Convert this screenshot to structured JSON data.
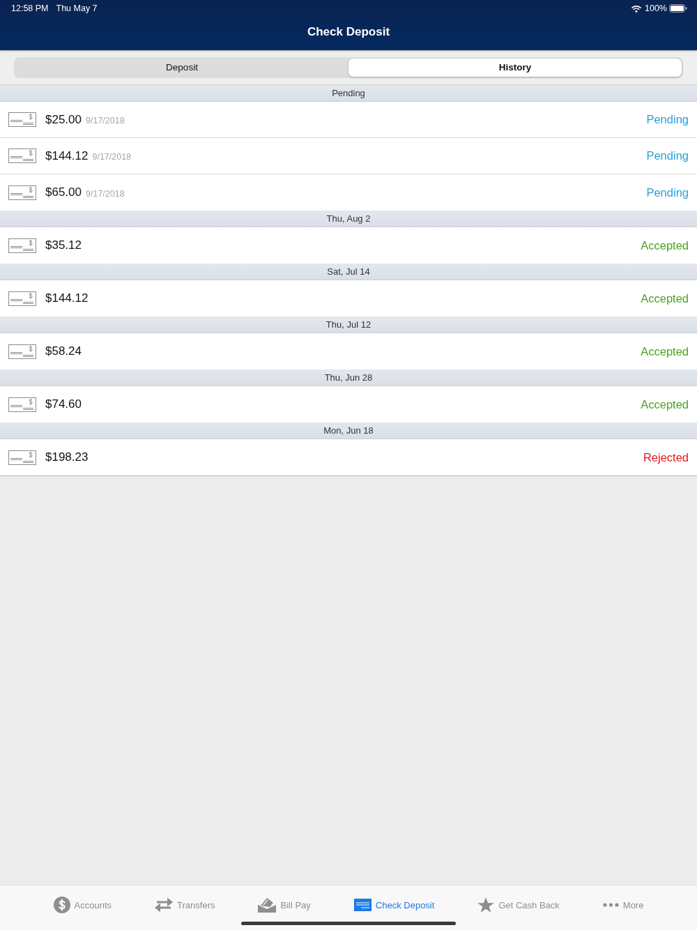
{
  "status_bar": {
    "time": "12:58 PM",
    "date": "Thu May 7",
    "battery": "100%"
  },
  "nav": {
    "title": "Check Deposit"
  },
  "segments": [
    {
      "label": "Deposit",
      "selected": false
    },
    {
      "label": "History",
      "selected": true
    }
  ],
  "sections": [
    {
      "header": "Pending",
      "items": [
        {
          "amount": "$25.00",
          "date": "9/17/2018",
          "status": "Pending",
          "color": "#2a9fd8"
        },
        {
          "amount": "$144.12",
          "date": "9/17/2018",
          "status": "Pending",
          "color": "#2a9fd8"
        },
        {
          "amount": "$65.00",
          "date": "9/17/2018",
          "status": "Pending",
          "color": "#2a9fd8"
        }
      ]
    },
    {
      "header": "Thu, Aug 2",
      "items": [
        {
          "amount": "$35.12",
          "status": "Accepted",
          "color": "#4aa31c"
        }
      ]
    },
    {
      "header": "Sat, Jul 14",
      "items": [
        {
          "amount": "$144.12",
          "status": "Accepted",
          "color": "#4aa31c"
        }
      ]
    },
    {
      "header": "Thu, Jul 12",
      "items": [
        {
          "amount": "$58.24",
          "status": "Accepted",
          "color": "#4aa31c"
        }
      ]
    },
    {
      "header": "Thu, Jun 28",
      "items": [
        {
          "amount": "$74.60",
          "status": "Accepted",
          "color": "#4aa31c"
        }
      ]
    },
    {
      "header": "Mon, Jun 18",
      "items": [
        {
          "amount": "$198.23",
          "status": "Rejected",
          "color": "#e8141b"
        }
      ]
    }
  ],
  "tab_bar": [
    {
      "label": "Accounts",
      "selected": false
    },
    {
      "label": "Transfers",
      "selected": false
    },
    {
      "label": "Bill Pay",
      "selected": false
    },
    {
      "label": "Check Deposit",
      "selected": true
    },
    {
      "label": "Get Cash Back",
      "selected": false
    },
    {
      "label": "More",
      "selected": false
    }
  ]
}
